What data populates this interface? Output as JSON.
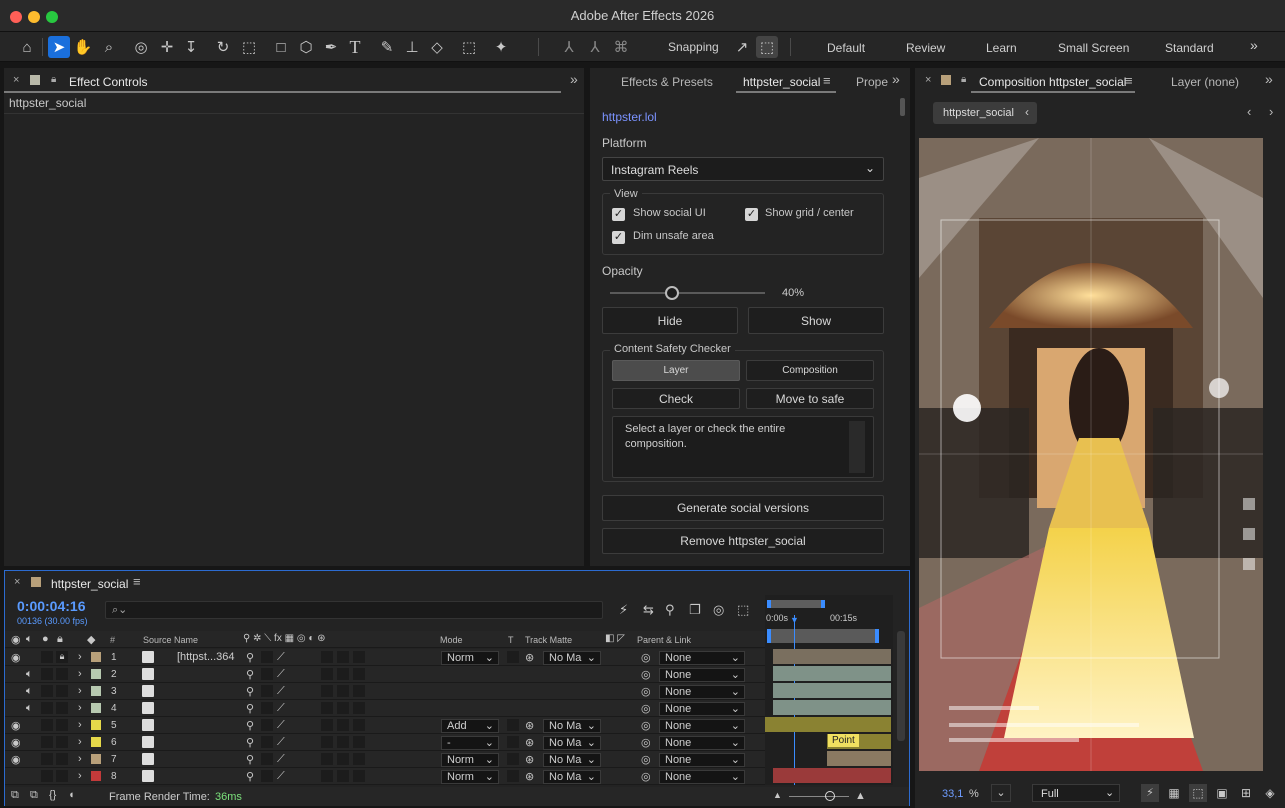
{
  "window": {
    "title": "Adobe After Effects 2026"
  },
  "toolbar": {
    "snapping_label": "Snapping"
  },
  "workspaces": [
    "Default",
    "Review",
    "Learn",
    "Small Screen",
    "Standard"
  ],
  "effect_controls": {
    "tab": "Effect Controls",
    "subject": "httpster_social"
  },
  "middle_tabs": {
    "effects_presets": "Effects & Presets",
    "httpster": "httpster_social",
    "properties": "Prope"
  },
  "plugin": {
    "link": "httpster.lol",
    "platform_label": "Platform",
    "platform_value": "Instagram Reels",
    "view_label": "View",
    "show_social_ui": "Show social UI",
    "show_grid": "Show grid / center",
    "dim_unsafe": "Dim unsafe area",
    "opacity_label": "Opacity",
    "opacity_value": "40%",
    "opacity_fraction": 0.4,
    "hide": "Hide",
    "show": "Show",
    "safety_label": "Content Safety Checker",
    "layer": "Layer",
    "composition": "Composition",
    "check": "Check",
    "move_to_safe": "Move to safe",
    "message": "Select a layer or check the entire composition.",
    "generate": "Generate social versions",
    "remove": "Remove httpster_social"
  },
  "comp_viewer": {
    "tab": "Composition httpster_social",
    "layer_tab": "Layer (none)",
    "breadcrumb": "httpster_social",
    "zoom": "33,1",
    "zoom_unit": "%",
    "resolution": "Full"
  },
  "timeline": {
    "tab": "httpster_social",
    "timecode": "0:00:04:16",
    "frames": "00136 (30.00 fps)",
    "search_placeholder": "",
    "columns": {
      "num": "#",
      "source": "Source Name",
      "mode": "Mode",
      "t": "T",
      "track_matte": "Track Matte",
      "parent": "Parent & Link"
    },
    "ruler": {
      "start": "0:00s",
      "mark": "00:15s"
    },
    "layers": [
      {
        "num": "1",
        "name": "[httpst...364",
        "color": "#b8a07a",
        "mode": "Norm",
        "matte": "No Ma",
        "parent": "None",
        "eye": true,
        "audio": false,
        "lock": true
      },
      {
        "num": "2",
        "name": "",
        "color": "#b7c9b0",
        "mode": "",
        "matte": "",
        "parent": "None",
        "eye": false,
        "audio": true,
        "lock": false
      },
      {
        "num": "3",
        "name": "",
        "color": "#b7c9b0",
        "mode": "",
        "matte": "",
        "parent": "None",
        "eye": false,
        "audio": true,
        "lock": false
      },
      {
        "num": "4",
        "name": "",
        "color": "#b7c9b0",
        "mode": "",
        "matte": "",
        "parent": "None",
        "eye": false,
        "audio": true,
        "lock": false
      },
      {
        "num": "5",
        "name": "",
        "color": "#e6d94a",
        "mode": "Add",
        "matte": "No Ma",
        "parent": "None",
        "eye": true,
        "audio": false,
        "lock": false
      },
      {
        "num": "6",
        "name": "",
        "color": "#e6d94a",
        "mode": "-",
        "matte": "No Ma",
        "parent": "None",
        "eye": true,
        "audio": false,
        "lock": false
      },
      {
        "num": "7",
        "name": "",
        "color": "#b8a07a",
        "mode": "Norm",
        "matte": "No Ma",
        "parent": "None",
        "eye": true,
        "audio": false,
        "lock": false
      },
      {
        "num": "8",
        "name": "",
        "color": "#c23a3a",
        "mode": "Norm",
        "matte": "No Ma",
        "parent": "None",
        "eye": false,
        "audio": false,
        "lock": false
      }
    ],
    "point_label": "Point",
    "render_label": "Frame Render Time:",
    "render_value": "36ms"
  }
}
